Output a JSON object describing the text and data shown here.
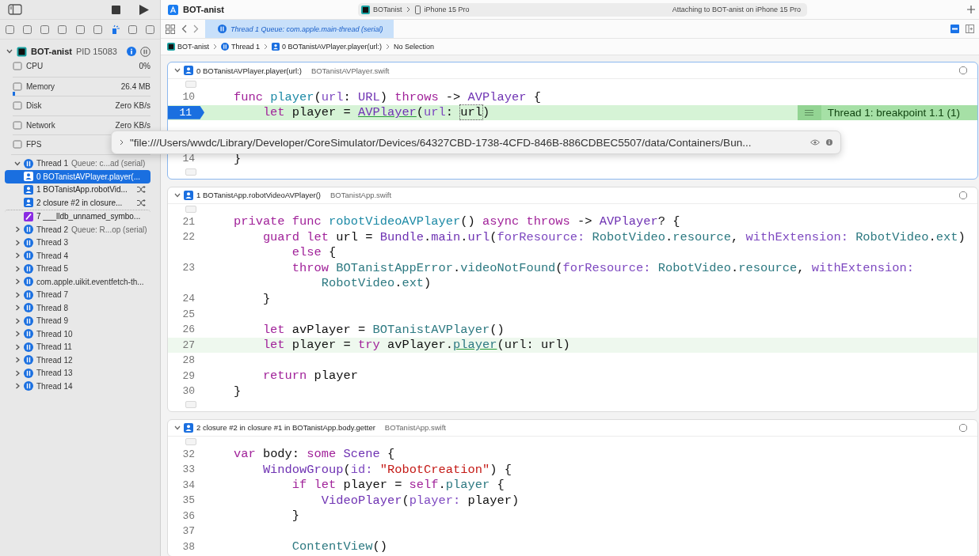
{
  "toolbar": {
    "title": "BOT-anist",
    "scheme": "BOTanist",
    "device": "iPhone 15 Pro",
    "status": "Attaching to BOT-anist on iPhone 15 Pro"
  },
  "navigator_tabs": [
    {
      "selected": false
    },
    {
      "selected": false
    },
    {
      "selected": false
    },
    {
      "selected": false
    },
    {
      "selected": false
    },
    {
      "selected": false
    },
    {
      "selected": true
    },
    {
      "selected": false
    },
    {
      "selected": false
    }
  ],
  "process": {
    "name": "BOT-anist",
    "pid": "PID 15083"
  },
  "gauges": [
    {
      "label": "CPU",
      "value": "0%"
    },
    {
      "label": "Memory",
      "value": "26.4 MB",
      "level": 0.02
    },
    {
      "label": "Disk",
      "value": "Zero KB/s"
    },
    {
      "label": "Network",
      "value": "Zero KB/s"
    },
    {
      "label": "FPS"
    }
  ],
  "threads": [
    {
      "label": "Thread 1",
      "queue": "Queue: c...ad (serial)",
      "expanded": true,
      "children": [
        {
          "label": "0 BOTanistAVPlayer.player(...",
          "kind": "user",
          "selected": true,
          "async": false
        },
        {
          "label": "1 BOTanistApp.robotVid...",
          "kind": "user",
          "selected": false,
          "async": true
        },
        {
          "label": "2 closure #2 in closure...",
          "kind": "user",
          "selected": false,
          "async": true
        },
        {
          "label": "7 ___lldb_unnamed_symbo...",
          "kind": "system",
          "selected": false,
          "async": false
        }
      ]
    },
    {
      "label": "Thread 2",
      "queue": "Queue: R...op (serial)",
      "expanded": false
    },
    {
      "label": "Thread 3",
      "expanded": false
    },
    {
      "label": "Thread 4",
      "expanded": false
    },
    {
      "label": "Thread 5",
      "expanded": false
    },
    {
      "label": "com.apple.uikit.eventfetch-th...",
      "expanded": false
    },
    {
      "label": "Thread 7",
      "expanded": false
    },
    {
      "label": "Thread 8",
      "expanded": false
    },
    {
      "label": "Thread 9",
      "expanded": false
    },
    {
      "label": "Thread 10",
      "expanded": false
    },
    {
      "label": "Thread 11",
      "expanded": false
    },
    {
      "label": "Thread 12",
      "expanded": false
    },
    {
      "label": "Thread 13",
      "expanded": false
    },
    {
      "label": "Thread 14",
      "expanded": false
    }
  ],
  "tab": {
    "title": "Thread 1 Queue: com.apple.main-thread (serial)"
  },
  "jump_bar": [
    "BOT-anist",
    "Thread 1",
    "0 BOTanistAVPlayer.player(url:)",
    "No Selection"
  ],
  "editors": [
    {
      "title": "0 BOTanistAVPlayer.player(url:)",
      "file": "BOTanistAVPlayer.swift",
      "focused": true,
      "lines": [
        {
          "num": "10",
          "current": false,
          "tokens": [
            {
              "kind": "kw",
              "text": "    func "
            },
            {
              "kind": "decl",
              "text": "player"
            },
            {
              "kind": "plain",
              "text": "("
            },
            {
              "kind": "label",
              "text": "url"
            },
            {
              "kind": "plain",
              "text": ": "
            },
            {
              "kind": "sys",
              "text": "URL"
            },
            {
              "kind": "plain",
              "text": ") "
            },
            {
              "kind": "kw",
              "text": "throws"
            },
            {
              "kind": "plain",
              "text": " -> "
            },
            {
              "kind": "sys",
              "text": "AVPlayer"
            },
            {
              "kind": "plain",
              "text": " {"
            }
          ]
        },
        {
          "num": "11",
          "current": true,
          "annotation": "Thread 1: breakpoint 1.1 (1)",
          "tokens": [
            {
              "kind": "kw",
              "text": "        let"
            },
            {
              "kind": "plain",
              "text": " player = "
            },
            {
              "kind": "link",
              "text": "AVPlayer"
            },
            {
              "kind": "plain",
              "text": "("
            },
            {
              "kind": "label",
              "text": "url"
            },
            {
              "kind": "plain",
              "text": ": "
            },
            {
              "kind": "hover",
              "text": "url"
            },
            {
              "kind": "plain",
              "text": ")"
            }
          ]
        },
        {
          "num": "14",
          "current": false,
          "tokens": [
            {
              "kind": "plain",
              "text": "    }"
            }
          ]
        }
      ]
    },
    {
      "title": "1 BOTanistApp.robotVideoAVPlayer()",
      "file": "BOTanistApp.swift",
      "focused": false,
      "lines": [
        {
          "num": "21",
          "current": false,
          "tokens": [
            {
              "kind": "kw",
              "text": "    private func "
            },
            {
              "kind": "decl",
              "text": "robotVideoAVPlayer"
            },
            {
              "kind": "plain",
              "text": "() "
            },
            {
              "kind": "kw",
              "text": "async throws"
            },
            {
              "kind": "plain",
              "text": " -> "
            },
            {
              "kind": "sys",
              "text": "AVPlayer"
            },
            {
              "kind": "plain",
              "text": "? {"
            }
          ]
        },
        {
          "num": "22",
          "current": false,
          "tokens": [
            {
              "kind": "kw",
              "text": "        guard let"
            },
            {
              "kind": "plain",
              "text": " url = "
            },
            {
              "kind": "sys",
              "text": "Bundle"
            },
            {
              "kind": "plain",
              "text": "."
            },
            {
              "kind": "sys",
              "text": "main"
            },
            {
              "kind": "plain",
              "text": "."
            },
            {
              "kind": "sys",
              "text": "url"
            },
            {
              "kind": "plain",
              "text": "("
            },
            {
              "kind": "label",
              "text": "forResource: "
            },
            {
              "kind": "proj",
              "text": "RobotVideo"
            },
            {
              "kind": "plain",
              "text": "."
            },
            {
              "kind": "proj",
              "text": "resource"
            },
            {
              "kind": "plain",
              "text": ", "
            },
            {
              "kind": "label",
              "text": "withExtension: "
            },
            {
              "kind": "proj",
              "text": "RobotVideo"
            },
            {
              "kind": "plain",
              "text": "."
            },
            {
              "kind": "proj",
              "text": "ext"
            },
            {
              "kind": "plain",
              "text": ")"
            }
          ]
        },
        {
          "current": false,
          "tokens": [
            {
              "kind": "kw",
              "text": "            else"
            },
            {
              "kind": "plain",
              "text": " {"
            }
          ]
        },
        {
          "num": "23",
          "current": false,
          "tokens": [
            {
              "kind": "kw",
              "text": "            throw "
            },
            {
              "kind": "proj",
              "text": "BOTanistAppError"
            },
            {
              "kind": "plain",
              "text": "."
            },
            {
              "kind": "proj",
              "text": "videoNotFound"
            },
            {
              "kind": "plain",
              "text": "("
            },
            {
              "kind": "label",
              "text": "forResource: "
            },
            {
              "kind": "proj",
              "text": "RobotVideo"
            },
            {
              "kind": "plain",
              "text": "."
            },
            {
              "kind": "proj",
              "text": "resource"
            },
            {
              "kind": "plain",
              "text": ", "
            },
            {
              "kind": "label",
              "text": "withExtension:"
            }
          ]
        },
        {
          "current": false,
          "tokens": [
            {
              "kind": "proj",
              "text": "                RobotVideo"
            },
            {
              "kind": "plain",
              "text": "."
            },
            {
              "kind": "proj",
              "text": "ext"
            },
            {
              "kind": "plain",
              "text": ")"
            }
          ]
        },
        {
          "num": "24",
          "current": false,
          "tokens": [
            {
              "kind": "plain",
              "text": "        }"
            }
          ]
        },
        {
          "num": "25",
          "current": false
        },
        {
          "num": "26",
          "current": false,
          "tokens": [
            {
              "kind": "kw",
              "text": "        let"
            },
            {
              "kind": "plain",
              "text": " avPlayer = "
            },
            {
              "kind": "proj",
              "text": "BOTanistAVPlayer"
            },
            {
              "kind": "plain",
              "text": "()"
            }
          ]
        },
        {
          "num": "27",
          "current": true,
          "tokens": [
            {
              "kind": "kw",
              "text": "        let"
            },
            {
              "kind": "plain",
              "text": " player = "
            },
            {
              "kind": "kw",
              "text": "try"
            },
            {
              "kind": "plain",
              "text": " avPlayer."
            },
            {
              "kind": "plink",
              "text": "player"
            },
            {
              "kind": "plain",
              "text": "(url: url)"
            }
          ]
        },
        {
          "num": "28",
          "current": false
        },
        {
          "num": "29",
          "current": false,
          "tokens": [
            {
              "kind": "kw",
              "text": "        return"
            },
            {
              "kind": "plain",
              "text": " player"
            }
          ]
        },
        {
          "num": "30",
          "current": false,
          "tokens": [
            {
              "kind": "plain",
              "text": "    }"
            }
          ]
        }
      ]
    },
    {
      "title": "2 closure #2 in closure #1 in BOTanistApp.body.getter",
      "file": "BOTanistApp.swift",
      "focused": false,
      "lines": [
        {
          "num": "32",
          "current": false,
          "tokens": [
            {
              "kind": "kw",
              "text": "    var"
            },
            {
              "kind": "plain",
              "text": " body: "
            },
            {
              "kind": "kw",
              "text": "some "
            },
            {
              "kind": "sys",
              "text": "Scene"
            },
            {
              "kind": "plain",
              "text": " {"
            }
          ]
        },
        {
          "num": "33",
          "current": false,
          "tokens": [
            {
              "kind": "sys",
              "text": "        WindowGroup"
            },
            {
              "kind": "plain",
              "text": "("
            },
            {
              "kind": "label",
              "text": "id: "
            },
            {
              "kind": "str",
              "text": "\"RobotCreation\""
            },
            {
              "kind": "plain",
              "text": ") {"
            }
          ]
        },
        {
          "num": "34",
          "current": false,
          "tokens": [
            {
              "kind": "kw",
              "text": "            if let"
            },
            {
              "kind": "plain",
              "text": " player = "
            },
            {
              "kind": "kw",
              "text": "self"
            },
            {
              "kind": "plain",
              "text": "."
            },
            {
              "kind": "proj",
              "text": "player"
            },
            {
              "kind": "plain",
              "text": " {"
            }
          ]
        },
        {
          "num": "35",
          "current": false,
          "tokens": [
            {
              "kind": "sys",
              "text": "                VideoPlayer"
            },
            {
              "kind": "plain",
              "text": "("
            },
            {
              "kind": "label",
              "text": "player:"
            },
            {
              "kind": "plain",
              "text": " player)"
            }
          ]
        },
        {
          "num": "36",
          "current": false,
          "tokens": [
            {
              "kind": "plain",
              "text": "            }"
            }
          ]
        },
        {
          "num": "37",
          "current": false
        },
        {
          "num": "38",
          "current": false,
          "tokens": [
            {
              "kind": "proj",
              "text": "            ContentView"
            },
            {
              "kind": "plain",
              "text": "()"
            }
          ]
        }
      ]
    }
  ],
  "tooltip": {
    "value": "\"file:///Users/wwdc/Library/Developer/CoreSimulator/Devices/64327CBD-1738-4CFD-846B-886CDBEC5507/data/Containers/Bun..."
  }
}
